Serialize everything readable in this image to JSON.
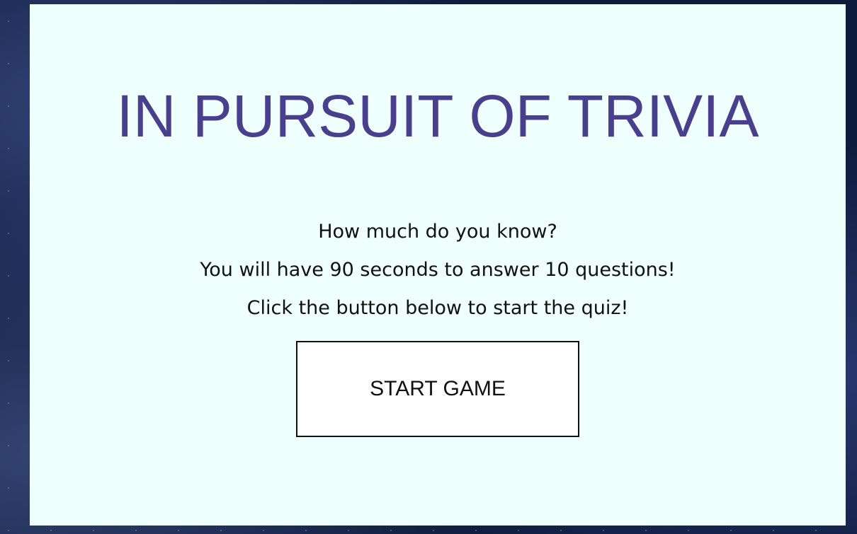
{
  "page": {
    "title": "IN PURSUIT OF TRIVIA",
    "intro_lines": [
      "How much do you know?",
      "You will have 90 seconds to answer 10 questions!",
      "Click the button below to start the quiz!"
    ],
    "start_button_label": "START GAME"
  },
  "colors": {
    "title": "#4a3f8e",
    "card_background": "#eefffd",
    "page_background": "#0d1b3d"
  }
}
